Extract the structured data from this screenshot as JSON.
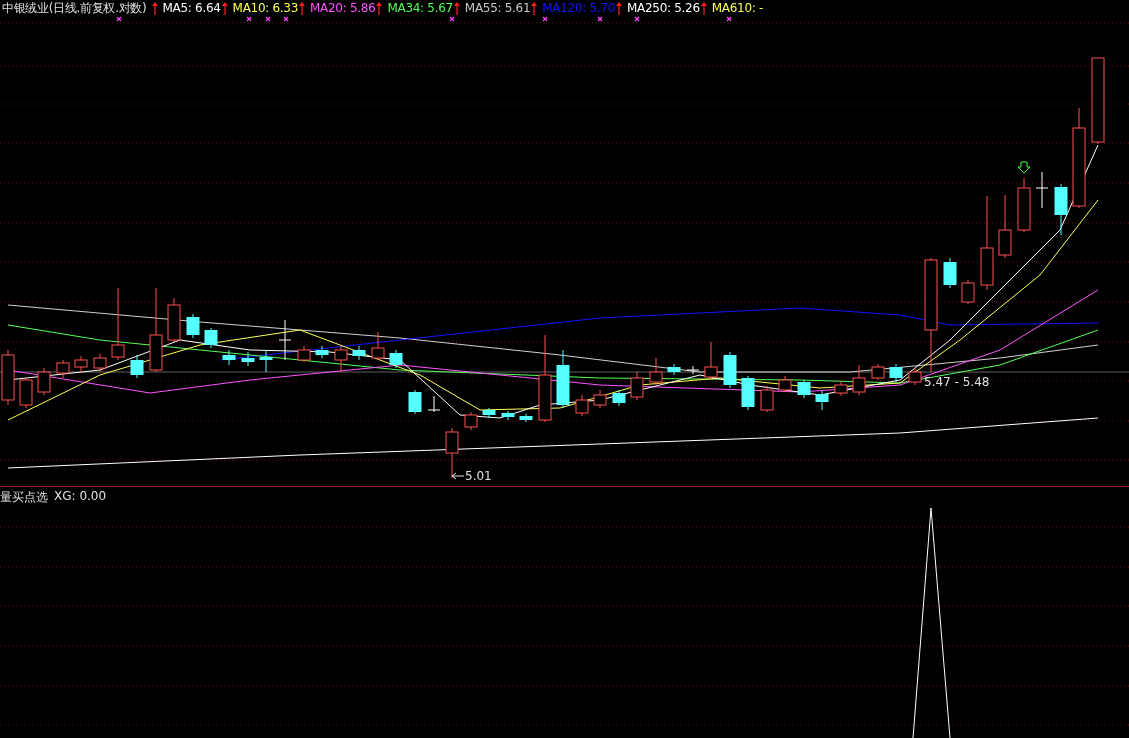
{
  "main_chart": {
    "title": "中银绒业(日线.前复权.对数)",
    "indicators": [
      {
        "label": "MA5: 6.64",
        "color": "#ffffff",
        "arrow": true
      },
      {
        "label": "MA10: 6.33",
        "color": "#ffff54",
        "arrow": true
      },
      {
        "label": "MA20: 5.86",
        "color": "#ff54ff",
        "arrow": true
      },
      {
        "label": "MA34: 5.67",
        "color": "#54ff54",
        "arrow": true
      },
      {
        "label": "MA55: 5.61",
        "color": "#c8c8c8",
        "arrow": true
      },
      {
        "label": "MA120: 5.70",
        "color": "#1414ff",
        "arrow": true
      },
      {
        "label": "MA250: 5.26",
        "color": "#ffffff",
        "arrow": true
      },
      {
        "label": "MA610: -",
        "color": "#ffff54",
        "arrow": false
      }
    ],
    "low_label": "5.01",
    "range_label": "5.47 - 5.48"
  },
  "sub_chart": {
    "title": "量买点选",
    "reading": "XG: 0.00"
  }
}
